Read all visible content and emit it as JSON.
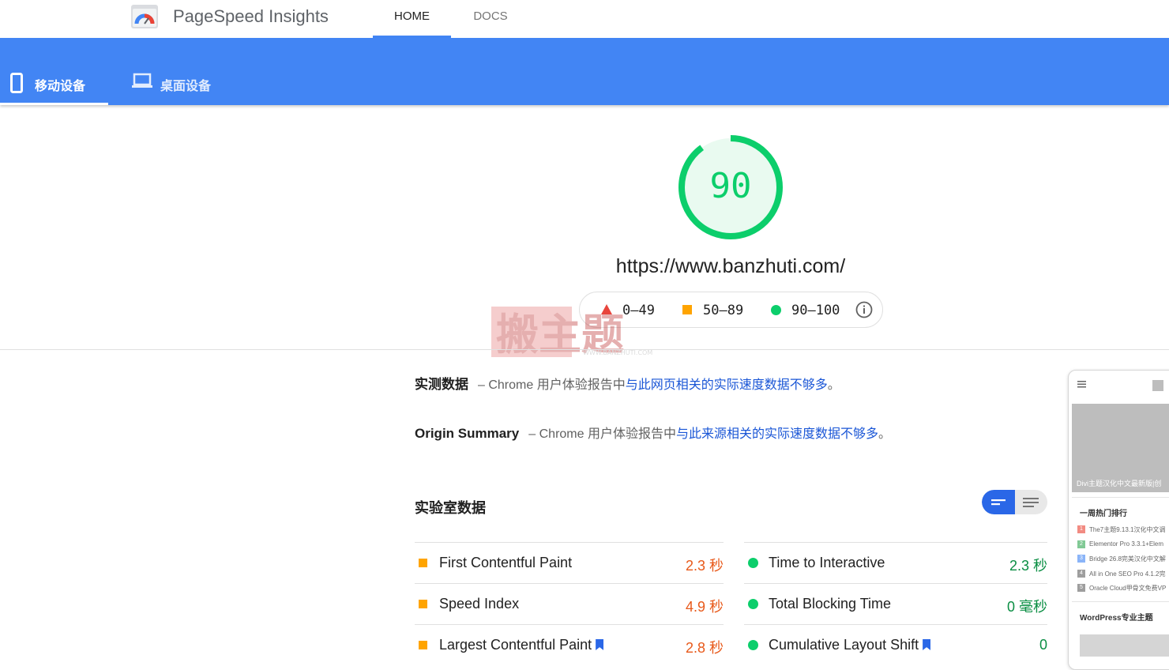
{
  "header": {
    "app_title": "PageSpeed Insights",
    "nav": {
      "home": "HOME",
      "docs": "DOCS"
    }
  },
  "device_tabs": {
    "mobile": "移动设备",
    "desktop": "桌面设备"
  },
  "score": {
    "value": "90",
    "fraction": 0.9,
    "color": "#0cce6b",
    "url": "https://www.banzhuti.com/"
  },
  "legend": {
    "fail": "0–49",
    "average": "50–89",
    "pass": "90–100"
  },
  "watermark": {
    "main": "搬主题",
    "sub": "WWW.BANZHUTI.COM"
  },
  "field_data": {
    "title": "实测数据",
    "desc": "– Chrome 用户体验报告中",
    "link": "与此网页相关的实际速度数据不够多",
    "end": "。"
  },
  "origin_summary": {
    "title": "Origin Summary",
    "desc": "– Chrome 用户体验报告中",
    "link": "与此来源相关的实际速度数据不够多",
    "end": "。"
  },
  "lab_data": {
    "title": "实验室数据",
    "metrics_left": [
      {
        "name": "First Contentful Paint",
        "value": "2.3 秒",
        "status": "average"
      },
      {
        "name": "Speed Index",
        "value": "4.9 秒",
        "status": "average"
      },
      {
        "name": "Largest Contentful Paint",
        "value": "2.8 秒",
        "status": "average"
      }
    ],
    "metrics_right": [
      {
        "name": "Time to Interactive",
        "value": "2.3 秒",
        "status": "pass"
      },
      {
        "name": "Total Blocking Time",
        "value": "0 毫秒",
        "status": "pass"
      },
      {
        "name": "Cumulative Layout Shift",
        "value": "0",
        "status": "pass"
      }
    ]
  },
  "preview": {
    "banner_text": "Divi主题汉化中文最新版|创",
    "hot_title": "一周热门排行",
    "hot_items": [
      {
        "n": "1",
        "text": "The7主题9.13.1汉化中文调",
        "color": "#f28b82"
      },
      {
        "n": "2",
        "text": "Elementor Pro 3.3.1+Elem",
        "color": "#81c995"
      },
      {
        "n": "3",
        "text": "Bridge 26.8完美汉化中文解",
        "color": "#8ab4f8"
      },
      {
        "n": "4",
        "text": "All in One SEO Pro 4.1.2完",
        "color": "#9e9e9e"
      },
      {
        "n": "5",
        "text": "Oracle Cloud甲骨文免费VP",
        "color": "#9e9e9e"
      }
    ],
    "wp_title": "WordPress专业主题"
  }
}
